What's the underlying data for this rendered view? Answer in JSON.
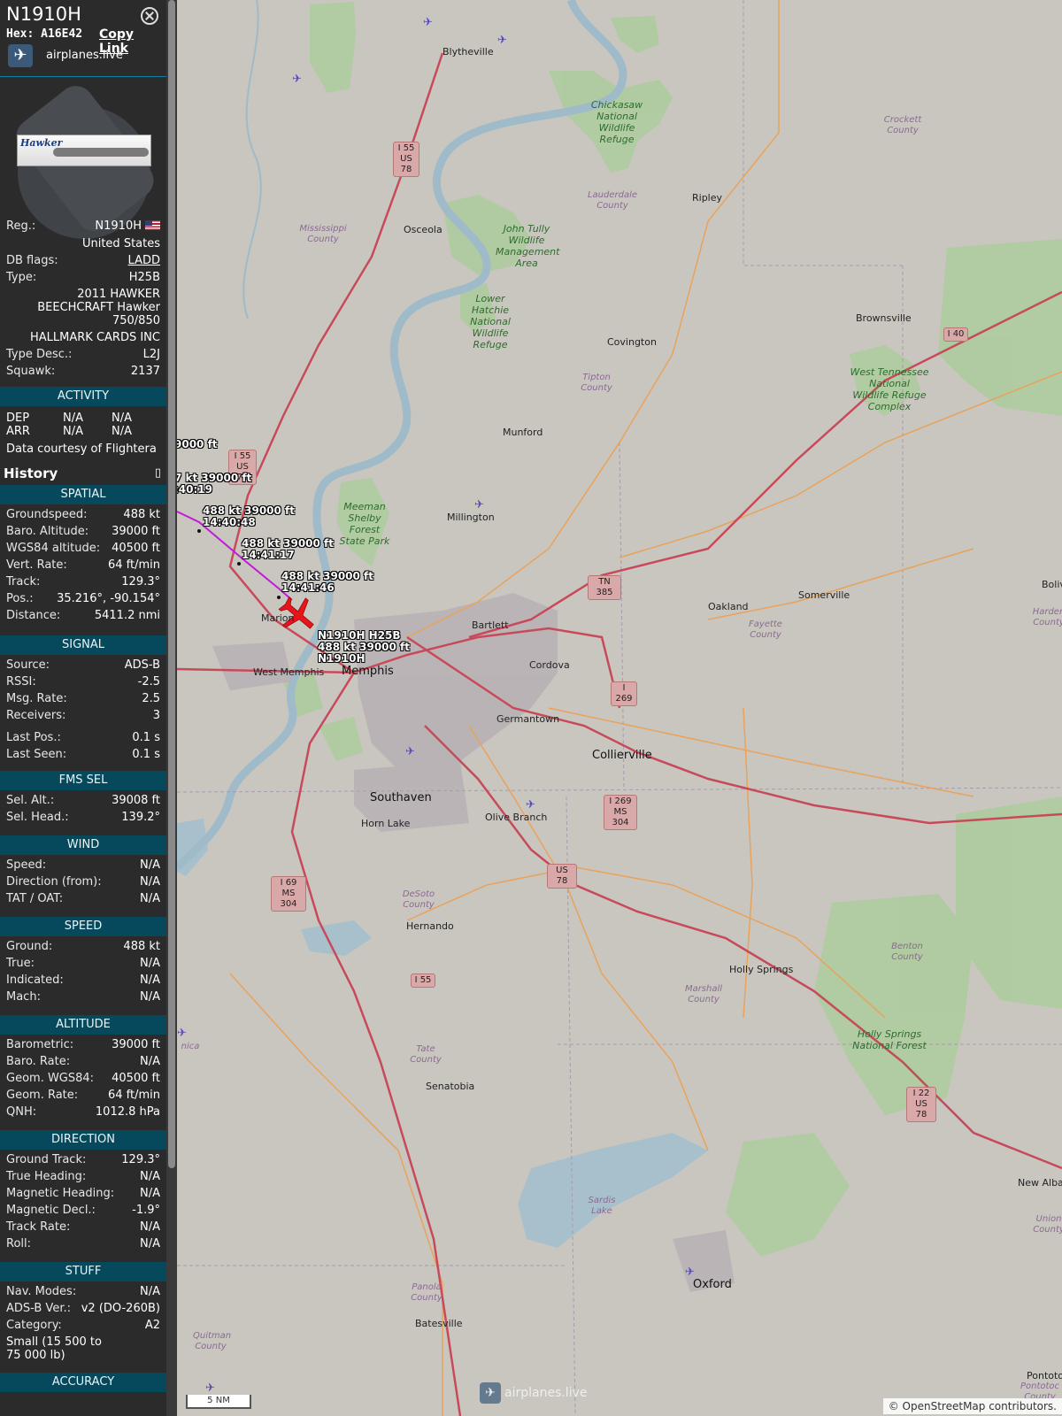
{
  "header": {
    "callsign": "N1910H",
    "hex_label": "Hex:",
    "hex": "A16E42",
    "copy_link": "Copy Link",
    "source_name": "airplanes.live"
  },
  "info": {
    "reg_label": "Reg.:",
    "reg": "N1910H",
    "country": "United States",
    "dbflags_label": "DB flags:",
    "dbflags": "LADD",
    "type_label": "Type:",
    "type": "H25B",
    "type_full_1": "2011 HAWKER",
    "type_full_2": "BEECHCRAFT Hawker",
    "type_full_3": "750/850",
    "owner": "HALLMARK CARDS INC",
    "typedesc_label": "Type Desc.:",
    "typedesc": "L2J",
    "squawk_label": "Squawk:",
    "squawk": "2137",
    "photo_text": "Hawker"
  },
  "activity": {
    "title": "ACTIVITY",
    "dep_label": "DEP",
    "dep1": "N/A",
    "dep2": "N/A",
    "arr_label": "ARR",
    "arr1": "N/A",
    "arr2": "N/A",
    "courtesy": "Data courtesy of",
    "courtesy_brand": "Flightera"
  },
  "history": {
    "title": "History"
  },
  "spatial": {
    "title": "SPATIAL",
    "rows": [
      {
        "k": "Groundspeed:",
        "v": "488 kt"
      },
      {
        "k": "Baro. Altitude:",
        "v": "39000 ft"
      },
      {
        "k": "WGS84 altitude:",
        "v": "40500 ft"
      },
      {
        "k": "Vert. Rate:",
        "v": "64 ft/min"
      },
      {
        "k": "Track:",
        "v": "129.3°"
      },
      {
        "k": "Pos.:",
        "v": "35.216°, -90.154°"
      },
      {
        "k": "Distance:",
        "v": "5411.2 nmi"
      }
    ]
  },
  "signal": {
    "title": "SIGNAL",
    "rows": [
      {
        "k": "Source:",
        "v": "ADS-B"
      },
      {
        "k": "RSSI:",
        "v": "-2.5"
      },
      {
        "k": "Msg. Rate:",
        "v": "2.5"
      },
      {
        "k": "Receivers:",
        "v": "3"
      },
      {
        "k": "Last Pos.:",
        "v": "0.1 s"
      },
      {
        "k": "Last Seen:",
        "v": "0.1 s"
      }
    ]
  },
  "fms": {
    "title": "FMS SEL",
    "rows": [
      {
        "k": "Sel. Alt.:",
        "v": "39008 ft"
      },
      {
        "k": "Sel. Head.:",
        "v": "139.2°"
      }
    ]
  },
  "wind": {
    "title": "WIND",
    "rows": [
      {
        "k": "Speed:",
        "v": "N/A"
      },
      {
        "k": "Direction (from):",
        "v": "N/A"
      },
      {
        "k": "TAT / OAT:",
        "v": "N/A"
      }
    ]
  },
  "speed": {
    "title": "SPEED",
    "rows": [
      {
        "k": "Ground:",
        "v": "488 kt"
      },
      {
        "k": "True:",
        "v": "N/A"
      },
      {
        "k": "Indicated:",
        "v": "N/A"
      },
      {
        "k": "Mach:",
        "v": "N/A"
      }
    ]
  },
  "altitude": {
    "title": "ALTITUDE",
    "rows": [
      {
        "k": "Barometric:",
        "v": "39000 ft"
      },
      {
        "k": "Baro. Rate:",
        "v": "N/A"
      },
      {
        "k": "Geom. WGS84:",
        "v": "40500 ft"
      },
      {
        "k": "Geom. Rate:",
        "v": "64 ft/min"
      },
      {
        "k": "QNH:",
        "v": "1012.8 hPa"
      }
    ]
  },
  "direction": {
    "title": "DIRECTION",
    "rows": [
      {
        "k": "Ground Track:",
        "v": "129.3°"
      },
      {
        "k": "True Heading:",
        "v": "N/A"
      },
      {
        "k": "Magnetic Heading:",
        "v": "N/A"
      },
      {
        "k": "Magnetic Decl.:",
        "v": "-1.9°"
      },
      {
        "k": "Track Rate:",
        "v": "N/A"
      },
      {
        "k": "Roll:",
        "v": "N/A"
      }
    ]
  },
  "stuff": {
    "title": "STUFF",
    "rows": [
      {
        "k": "Nav. Modes:",
        "v": "N/A"
      },
      {
        "k": "ADS-B Ver.:",
        "v": "v2 (DO-260B)"
      },
      {
        "k": "Category:",
        "v": "A2"
      }
    ],
    "category_desc_1": "Small (15 500 to",
    "category_desc_2": "75 000 lb)"
  },
  "accuracy": {
    "title": "ACCURACY"
  },
  "map": {
    "scale": "5 NM",
    "attribution": "© OpenStreetMap contributors.",
    "watermark": "airplanes.live",
    "aircraft_label_1": "N1910H H25B",
    "aircraft_label_2": "488 kt  39000 ft",
    "aircraft_label_3": "N1910H",
    "track_labels": [
      {
        "l1": "9000 ft",
        "l2": ""
      },
      {
        "l1": "7 kt  39000 ft",
        "l2": ":40:19"
      },
      {
        "l1": "488 kt  39000 ft",
        "l2": "14:40:48"
      },
      {
        "l1": "488 kt  39000 ft",
        "l2": "14:41:17"
      },
      {
        "l1": "488 kt  39000 ft",
        "l2": "14:41:46"
      }
    ],
    "places": [
      "Blytheville",
      "Osceola",
      "Ripley",
      "Covington",
      "Brownsville",
      "Munford",
      "Millington",
      "Marion",
      "West Memphis",
      "Memphis",
      "Bartlett",
      "Cordova",
      "Germantown",
      "Collierville",
      "Somerville",
      "Oakland",
      "Southaven",
      "Horn Lake",
      "Olive Branch",
      "Hernando",
      "Holly Springs",
      "Senatobia",
      "Batesville",
      "Oxford",
      "New Albany",
      "Pontotoc",
      "Boliva"
    ],
    "parks": [
      "Chickasaw National Wildlife Refuge",
      "John Tully Wildlife Management Area",
      "Lower Hatchie National Wildlife Refuge",
      "Meeman Shelby Forest State Park",
      "West Tennessee National Wildlife Refuge Complex",
      "Holly Springs National Forest"
    ],
    "counties": [
      "Mississippi County",
      "Lauderdale County",
      "Crockett County",
      "Tipton County",
      "Fayette County",
      "Harden County",
      "DeSoto County",
      "Marshall County",
      "Benton County",
      "Tate County",
      "Sardis Lake",
      "Panola County",
      "Quitman County",
      "Union County",
      "Pontotoc County",
      "nica"
    ],
    "shields": [
      "I 55 US 78",
      "I 55 US 78",
      "I 40",
      "TN 385",
      "I 269",
      "I 269 MS 304",
      "US 78",
      "I 69 MS 304",
      "I 55",
      "I 22 US 78"
    ]
  },
  "colors": {
    "sidebar_bg": "#2b2b2b",
    "section_bg": "#06495c",
    "track": "#c21bd6",
    "aircraft": "#e8141c"
  }
}
